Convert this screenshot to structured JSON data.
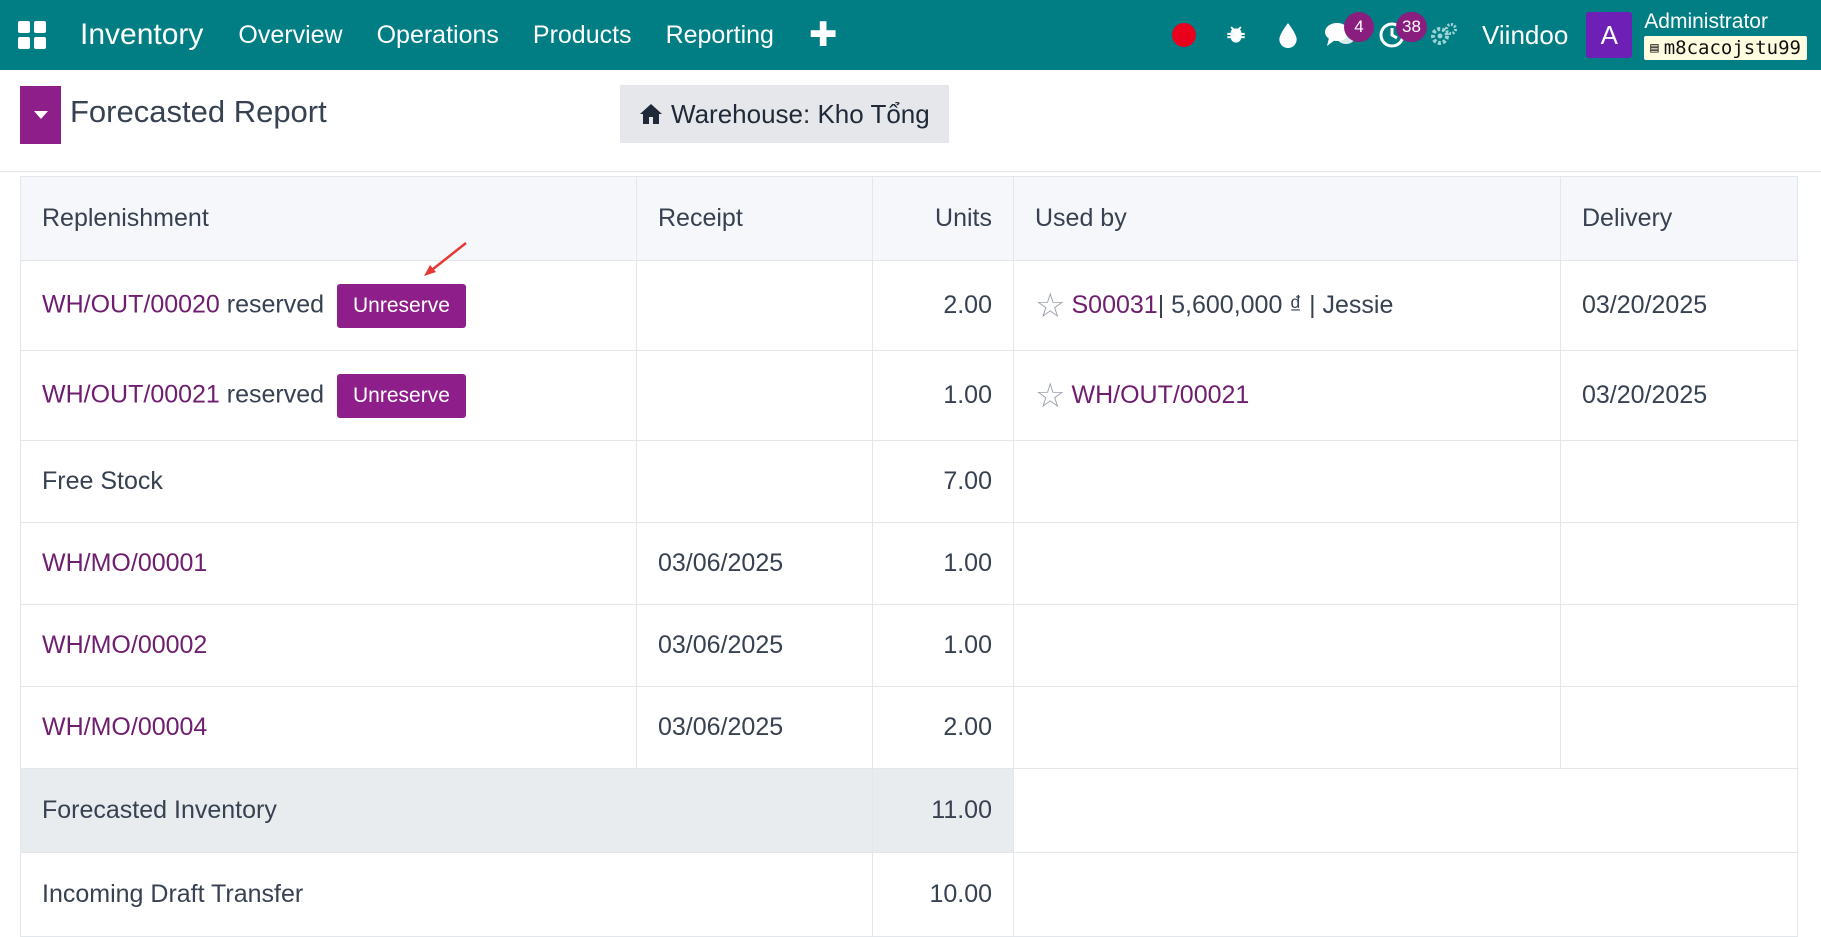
{
  "navbar": {
    "brand": "Inventory",
    "menu": [
      "Overview",
      "Operations",
      "Products",
      "Reporting"
    ],
    "plus": "✚",
    "messages_badge": "4",
    "activities_badge": "38",
    "company": "Viindoo",
    "avatar_letter": "A",
    "user_name": "Administrator",
    "db_name": "m8cacojstu99"
  },
  "control": {
    "title": "Forecasted Report",
    "warehouse_label": "Warehouse: Kho Tổng"
  },
  "table": {
    "headers": [
      "Replenishment",
      "Receipt",
      "Units",
      "Used by",
      "Delivery"
    ],
    "rows": [
      {
        "ref": "WH/OUT/00020",
        "status": "reserved",
        "action": "Unreserve",
        "receipt": "",
        "units": "2.00",
        "used_ref": "S00031",
        "used_rest": " | 5,600,000 ₫ | Jessie",
        "delivery": "03/20/2025"
      },
      {
        "ref": "WH/OUT/00021",
        "status": "reserved",
        "action": "Unreserve",
        "receipt": "",
        "units": "1.00",
        "used_ref": "WH/OUT/00021",
        "used_rest": "",
        "delivery": "03/20/2025"
      },
      {
        "ref": "Free Stock",
        "receipt": "",
        "units": "7.00"
      },
      {
        "ref": "WH/MO/00001",
        "receipt": "03/06/2025",
        "units": "1.00"
      },
      {
        "ref": "WH/MO/00002",
        "receipt": "03/06/2025",
        "units": "1.00"
      },
      {
        "ref": "WH/MO/00004",
        "receipt": "03/06/2025",
        "units": "2.00"
      }
    ],
    "forecast_label": "Forecasted Inventory",
    "forecast_units": "11.00",
    "incoming_label": "Incoming Draft Transfer",
    "incoming_units": "10.00"
  },
  "colors": {
    "navbar": "#017e84",
    "primary": "#8e1f8a",
    "link": "#6f1e6f",
    "annotation": "#e53935"
  }
}
